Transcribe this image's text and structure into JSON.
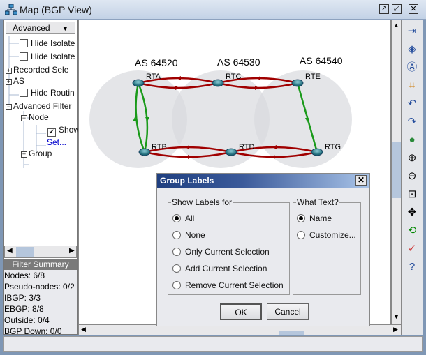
{
  "window": {
    "title": "Map (BGP View)",
    "icon": "network-map-icon"
  },
  "left_panel": {
    "dropdown": "Advanced",
    "tree": [
      {
        "label": "Hide Isolate",
        "type": "checkbox",
        "checked": false
      },
      {
        "label": "Hide Isolate",
        "type": "checkbox",
        "checked": false
      },
      {
        "label": "Recorded Sele",
        "type": "expander",
        "expanded": false
      },
      {
        "label": "AS",
        "type": "expander",
        "expanded": false
      },
      {
        "label": "Hide Routin",
        "type": "checkbox",
        "checked": false
      },
      {
        "label": "Advanced Filter",
        "type": "expander",
        "expanded": true
      },
      {
        "label": "Node",
        "type": "expander",
        "expanded": true
      },
      {
        "label": "Show",
        "type": "checkbox",
        "checked": true
      },
      {
        "label": "Set...",
        "type": "link"
      },
      {
        "label": "Group",
        "type": "expander",
        "expanded": false
      }
    ],
    "summary_title": "Filter Summary",
    "summary": [
      "Nodes: 6/8",
      "Pseudo-nodes: 0/2",
      "IBGP: 3/3",
      "EBGP: 8/8",
      "Outside: 0/4",
      "BGP Down: 0/0"
    ]
  },
  "map": {
    "as_groups": [
      "AS 64520",
      "AS 64530",
      "AS 64540"
    ],
    "routers": [
      "RTA",
      "RTB",
      "RTC",
      "RTD",
      "RTE",
      "RTG"
    ],
    "colors": {
      "ebgp": "#a00000",
      "ibgp": "#1a9a1a",
      "as_circle": "#e4e6ea",
      "router": "#2f7f8f"
    }
  },
  "toolbar": [
    "fit-icon",
    "3d-icon",
    "layout-icon",
    "select-nodes-icon",
    "undo-icon",
    "redo-icon",
    "globe-icon",
    "zoom-in-icon",
    "zoom-out-icon",
    "zoom-fit-icon",
    "pan-icon",
    "rotate-icon",
    "report-icon",
    "help-icon"
  ],
  "dialog": {
    "title": "Group Labels",
    "show_labels_for": {
      "legend": "Show Labels for",
      "options": [
        "All",
        "None",
        "Only Current Selection",
        "Add Current Selection",
        "Remove Current Selection"
      ],
      "selected": "All"
    },
    "what_text": {
      "legend": "What Text?",
      "options": [
        "Name",
        "Customize..."
      ],
      "selected": "Name"
    },
    "ok": "OK",
    "cancel": "Cancel"
  }
}
